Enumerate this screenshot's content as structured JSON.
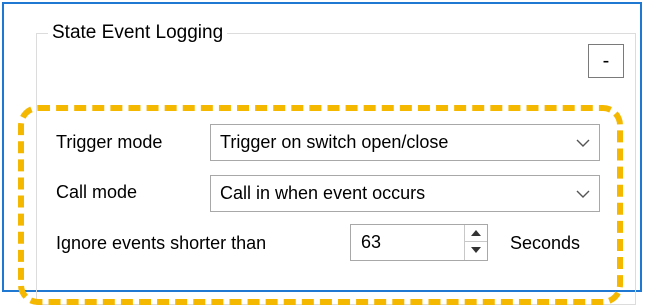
{
  "group": {
    "title": "State Event Logging",
    "collapse_label": "-"
  },
  "fields": {
    "trigger_mode": {
      "label": "Trigger mode",
      "value": "Trigger on switch open/close"
    },
    "call_mode": {
      "label": "Call mode",
      "value": "Call in when event occurs"
    },
    "ignore_events": {
      "label": "Ignore events shorter than",
      "value": "63",
      "unit": "Seconds"
    }
  },
  "icons": {
    "combo_dropdown": "chevron-down-icon",
    "spin_up": "arrow-up-icon",
    "spin_down": "arrow-down-icon"
  },
  "colors": {
    "frame_border": "#1f78d1",
    "highlight_dashes": "#f5b800"
  }
}
